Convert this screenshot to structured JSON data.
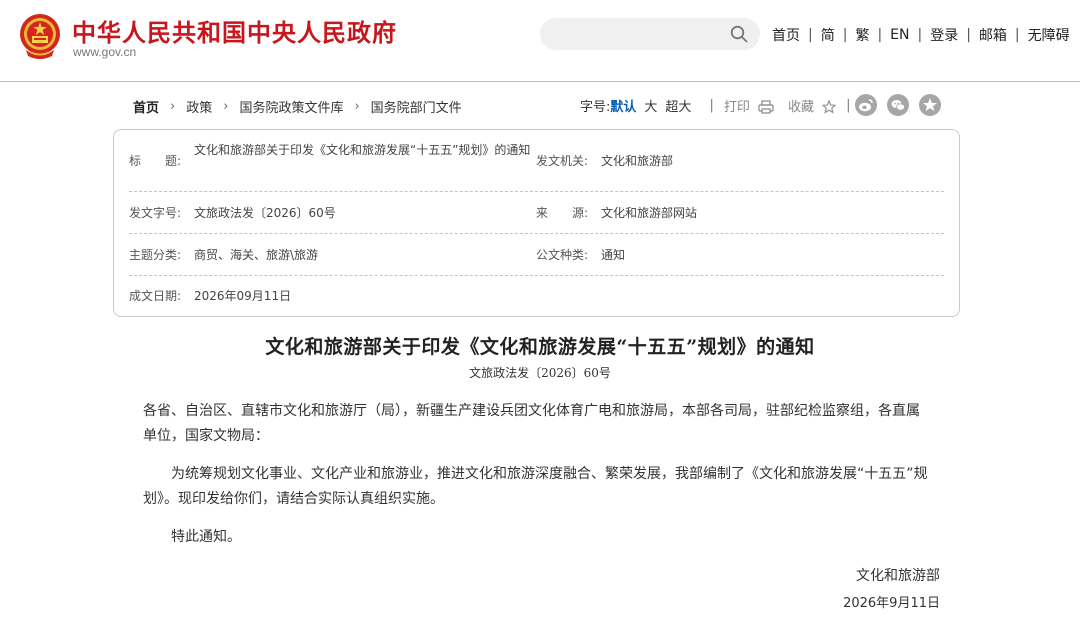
{
  "header": {
    "site_title": "中华人民共和国中央人民政府",
    "site_url": "www.gov.cn",
    "search_placeholder": "",
    "nav": [
      "首页",
      "简",
      "繁",
      "EN",
      "登录",
      "邮箱",
      "无障碍"
    ],
    "nav_separator": "|"
  },
  "colors": {
    "brand_red": "#c8161d",
    "link_blue": "#0b5db5",
    "icon_grey": "#a6a6a6"
  },
  "breadcrumb": {
    "items": [
      "首页",
      "政策",
      "国务院政策文件库",
      "国务院部门文件"
    ],
    "arrow": "›"
  },
  "tools": {
    "font_size_label": "字号:",
    "font_sizes": [
      "默认",
      "大",
      "超大"
    ],
    "print_label": "打印",
    "favorite_label": "收藏",
    "share_icons": [
      "weibo-icon",
      "wechat-icon",
      "qzone-icon"
    ],
    "separator": "|"
  },
  "info": {
    "title_label": "标　　题:",
    "title_value": "文化和旅游部关于印发《文化和旅游发展“十五五”规划》的通知",
    "issuer_label": "发文机关:",
    "issuer_value": "文化和旅游部",
    "docno_label": "发文字号:",
    "docno_value": "文旅政法发〔2026〕60号",
    "source_label": "来　　源:",
    "source_value": "文化和旅游部网站",
    "topic_label": "主题分类:",
    "topic_value": "商贸、海关、旅游\\旅游",
    "type_label": "公文种类:",
    "type_value": "通知",
    "date_label": "成文日期:",
    "date_value": "2026年09月11日"
  },
  "article": {
    "title": "文化和旅游部关于印发《文化和旅游发展“十五五”规划》的通知",
    "doc_number": "文旅政法发〔2026〕60号",
    "paragraphs": [
      "各省、自治区、直辖市文化和旅游厅（局），新疆生产建设兵团文化体育广电和旅游局，本部各司局，驻部纪检监察组，各直属单位，国家文物局：",
      "为统筹规划文化事业、文化产业和旅游业，推进文化和旅游深度融合、繁荣发展，我部编制了《文化和旅游发展“十五五”规划》。现印发给你们，请结合实际认真组织实施。",
      "特此通知。"
    ],
    "signer": "文化和旅游部",
    "sign_date": "2026年9月11日"
  }
}
